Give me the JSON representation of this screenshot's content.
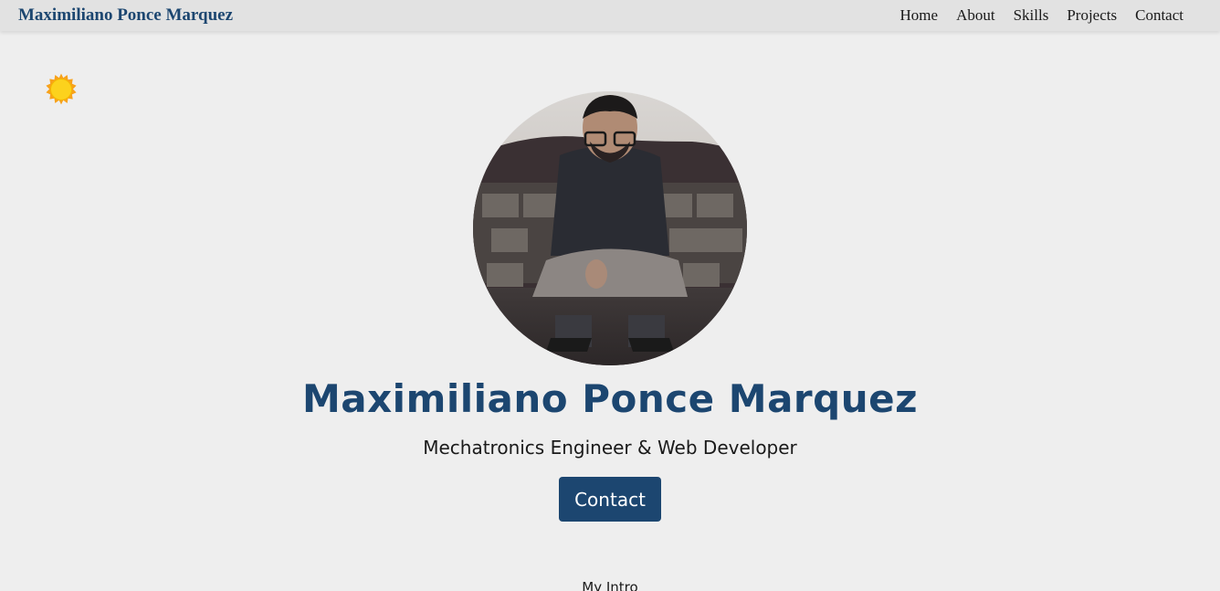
{
  "navbar": {
    "brand": "Maximiliano Ponce Marquez",
    "links": [
      "Home",
      "About",
      "Skills",
      "Projects",
      "Contact"
    ]
  },
  "theme_toggle": {
    "icon": "sun-icon"
  },
  "hero": {
    "avatar": "profile-photo",
    "name": "Maximiliano Ponce Marquez",
    "role": "Mechatronics Engineer & Web Developer",
    "contact_button": "Contact"
  },
  "intro": {
    "label": "My Intro"
  },
  "colors": {
    "accent": "#1c4670",
    "background": "#eeeeee",
    "navbar": "#e2e2e2",
    "sun": "#f5b800"
  }
}
